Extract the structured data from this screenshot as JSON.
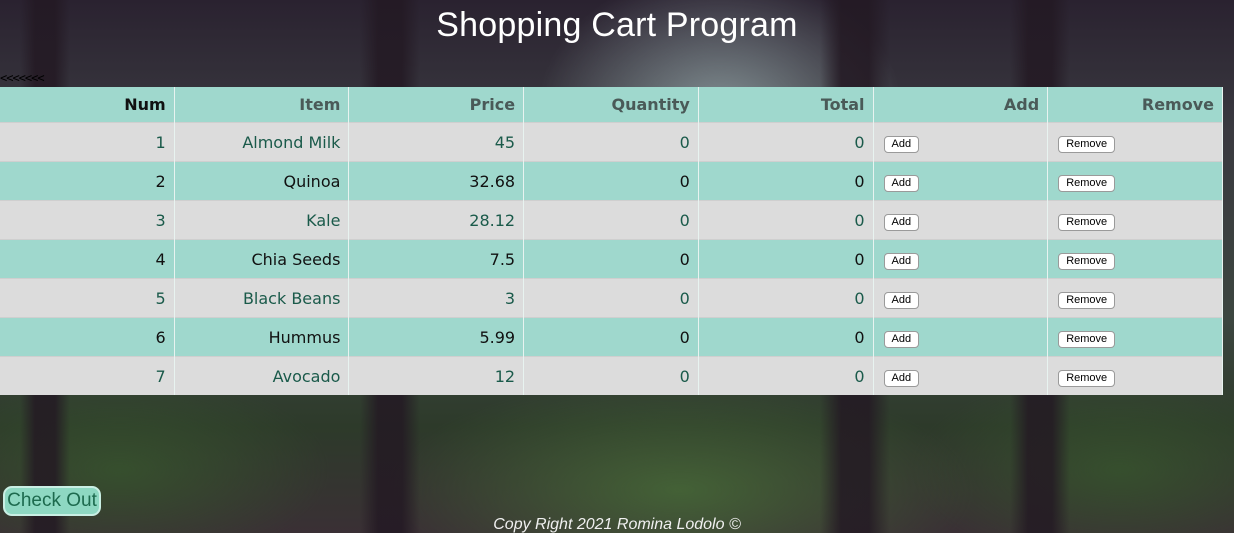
{
  "page": {
    "title": "Shopping Cart Program",
    "back_link": "<<<<<<<",
    "checkout_label": "Check Out",
    "footer": "Copy Right 2021 Romina Lodolo ©"
  },
  "table": {
    "headers": [
      "Num",
      "Item",
      "Price",
      "Quantity",
      "Total",
      "Add",
      "Remove"
    ],
    "add_label": "Add",
    "remove_label": "Remove",
    "rows": [
      {
        "num": "1",
        "item": "Almond Milk",
        "price": "45",
        "quantity": "0",
        "total": "0"
      },
      {
        "num": "2",
        "item": "Quinoa",
        "price": "32.68",
        "quantity": "0",
        "total": "0"
      },
      {
        "num": "3",
        "item": "Kale",
        "price": "28.12",
        "quantity": "0",
        "total": "0"
      },
      {
        "num": "4",
        "item": "Chia Seeds",
        "price": "7.5",
        "quantity": "0",
        "total": "0"
      },
      {
        "num": "5",
        "item": "Black Beans",
        "price": "3",
        "quantity": "0",
        "total": "0"
      },
      {
        "num": "6",
        "item": "Hummus",
        "price": "5.99",
        "quantity": "0",
        "total": "0"
      },
      {
        "num": "7",
        "item": "Avocado",
        "price": "12",
        "quantity": "0",
        "total": "0"
      }
    ]
  },
  "colors": {
    "header_row": "#9fd8cd",
    "odd_row": "#dcdcdc",
    "even_row": "#9fd8cd",
    "checkout_button": "#8ed8c2"
  }
}
